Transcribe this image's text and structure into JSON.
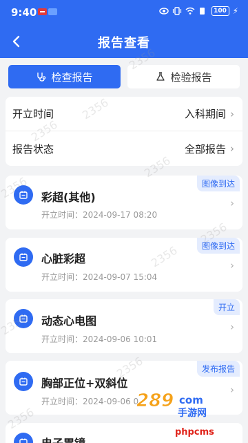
{
  "status_bar": {
    "time": "9:40",
    "battery": "100"
  },
  "header": {
    "title": "报告查看"
  },
  "tabs": [
    {
      "label": "检查报告",
      "active": true
    },
    {
      "label": "检验报告",
      "active": false
    }
  ],
  "filters": [
    {
      "label": "开立时间",
      "value": "入科期间"
    },
    {
      "label": "报告状态",
      "value": "全部报告"
    }
  ],
  "reports": [
    {
      "name": "彩超(其他)",
      "time": "开立时间：2024-09-17 08:20",
      "badge": "图像到达"
    },
    {
      "name": "心脏彩超",
      "time": "开立时间：2024-09-07 15:04",
      "badge": "图像到达"
    },
    {
      "name": "动态心电图",
      "time": "开立时间：2024-09-06 10:01",
      "badge": "开立"
    },
    {
      "name": "胸部正位+双斜位",
      "time": "开立时间：2024-09-06 0",
      "badge": "发布报告"
    },
    {
      "name": "电子胃镜",
      "time": "",
      "badge": ""
    }
  ],
  "watermark_text": "2356",
  "overlay": {
    "logo_text": "289",
    "logo_suffix": "com",
    "logo_sub": "手游网",
    "site_text": "phpcms"
  },
  "colors": {
    "primary": "#2f6bf2",
    "background": "#f2f3f5",
    "badge_bg": "#e4ecfe"
  }
}
